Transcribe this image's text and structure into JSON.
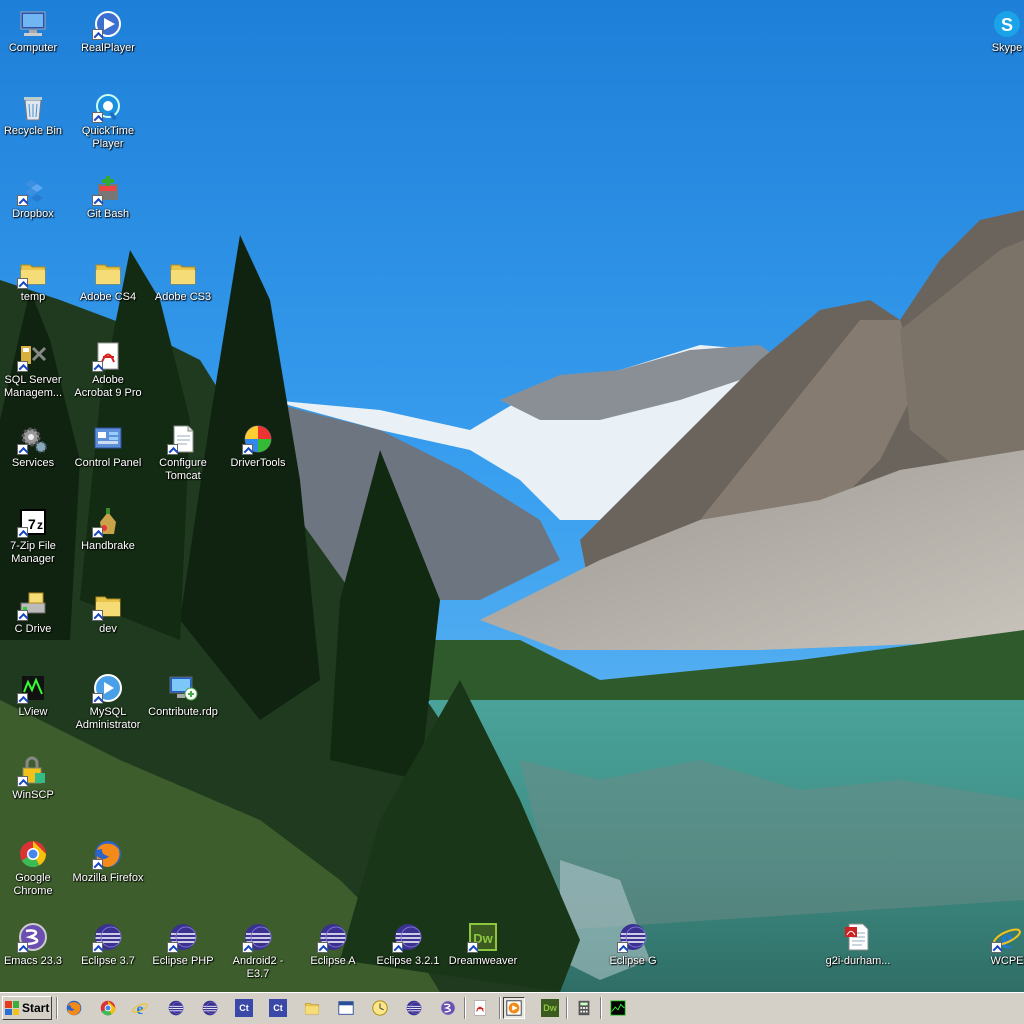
{
  "desktop": {
    "icons": [
      {
        "id": "computer",
        "label": "Computer",
        "icon": "computer-icon",
        "shortcut": false
      },
      {
        "id": "realplayer",
        "label": "RealPlayer",
        "icon": "realplayer-icon",
        "shortcut": true
      },
      {
        "id": "skype",
        "label": "Skype",
        "icon": "skype-icon",
        "shortcut": false
      },
      {
        "id": "recycle-bin",
        "label": "Recycle Bin",
        "icon": "recycle-bin-icon",
        "shortcut": false
      },
      {
        "id": "quicktime",
        "label": "QuickTime Player",
        "icon": "quicktime-icon",
        "shortcut": true
      },
      {
        "id": "dropbox",
        "label": "Dropbox",
        "icon": "dropbox-icon",
        "shortcut": true
      },
      {
        "id": "git-bash",
        "label": "Git Bash",
        "icon": "git-bash-icon",
        "shortcut": true
      },
      {
        "id": "temp",
        "label": "temp",
        "icon": "folder-icon",
        "shortcut": true
      },
      {
        "id": "adobe-cs4",
        "label": "Adobe CS4",
        "icon": "folder-icon",
        "shortcut": false
      },
      {
        "id": "adobe-cs3",
        "label": "Adobe CS3",
        "icon": "folder-icon",
        "shortcut": false
      },
      {
        "id": "sql-server",
        "label": "SQL Server Managem...",
        "icon": "sql-server-icon",
        "shortcut": true
      },
      {
        "id": "acrobat",
        "label": "Adobe Acrobat 9 Pro",
        "icon": "acrobat-icon",
        "shortcut": true
      },
      {
        "id": "services",
        "label": "Services",
        "icon": "services-gear-icon",
        "shortcut": true
      },
      {
        "id": "control-panel",
        "label": "Control Panel",
        "icon": "control-panel-icon",
        "shortcut": false
      },
      {
        "id": "configure-tomcat",
        "label": "Configure Tomcat",
        "icon": "document-icon",
        "shortcut": true
      },
      {
        "id": "drivertools",
        "label": "DriverTools",
        "icon": "drivertools-icon",
        "shortcut": true
      },
      {
        "id": "7zip",
        "label": "7-Zip File Manager",
        "icon": "7zip-icon",
        "shortcut": true
      },
      {
        "id": "handbrake",
        "label": "Handbrake",
        "icon": "handbrake-icon",
        "shortcut": true
      },
      {
        "id": "c-drive",
        "label": "C Drive",
        "icon": "drive-icon",
        "shortcut": true
      },
      {
        "id": "dev",
        "label": "dev",
        "icon": "folder-icon",
        "shortcut": true
      },
      {
        "id": "lview",
        "label": "LView",
        "icon": "lview-icon",
        "shortcut": true
      },
      {
        "id": "mysql-admin",
        "label": "MySQL Administrator",
        "icon": "mysql-icon",
        "shortcut": true
      },
      {
        "id": "contribute-rdp",
        "label": "Contribute.rdp",
        "icon": "remote-desktop-icon",
        "shortcut": false
      },
      {
        "id": "winscp",
        "label": "WinSCP",
        "icon": "winscp-icon",
        "shortcut": true
      },
      {
        "id": "chrome",
        "label": "Google Chrome",
        "icon": "chrome-icon",
        "shortcut": false
      },
      {
        "id": "firefox",
        "label": "Mozilla Firefox",
        "icon": "firefox-icon",
        "shortcut": true
      },
      {
        "id": "emacs",
        "label": "Emacs 23.3",
        "icon": "emacs-icon",
        "shortcut": true
      },
      {
        "id": "eclipse-37",
        "label": "Eclipse 3.7",
        "icon": "eclipse-icon",
        "shortcut": true
      },
      {
        "id": "eclipse-php",
        "label": "Eclipse PHP",
        "icon": "eclipse-icon",
        "shortcut": true
      },
      {
        "id": "android2",
        "label": "Android2 - E3.7",
        "icon": "eclipse-icon",
        "shortcut": true
      },
      {
        "id": "eclipse-a",
        "label": "Eclipse A",
        "icon": "eclipse-icon",
        "shortcut": true
      },
      {
        "id": "eclipse-321",
        "label": "Eclipse 3.2.1",
        "icon": "eclipse-icon",
        "shortcut": true
      },
      {
        "id": "dreamweaver",
        "label": "Dreamweaver",
        "icon": "dreamweaver-icon",
        "shortcut": true
      },
      {
        "id": "eclipse-g",
        "label": "Eclipse G",
        "icon": "eclipse-icon",
        "shortcut": true
      },
      {
        "id": "g2i-durham",
        "label": "g2i-durham...",
        "icon": "pdf-document-icon",
        "shortcut": false
      },
      {
        "id": "wcpe",
        "label": "WCPE",
        "icon": "ie-icon",
        "shortcut": true
      }
    ]
  },
  "taskbar": {
    "start_label": "Start",
    "quicklaunch": [
      {
        "icon": "firefox-icon",
        "text": ""
      },
      {
        "icon": "chrome-icon",
        "text": ""
      },
      {
        "icon": "ie-icon",
        "text": ""
      },
      {
        "icon": "eclipse-icon",
        "text": ""
      },
      {
        "icon": "eclipse-icon",
        "text": ""
      },
      {
        "icon": "ct-icon",
        "text": "Ct"
      },
      {
        "icon": "ct-icon",
        "text": "Ct"
      },
      {
        "icon": "folder-icon",
        "text": ""
      },
      {
        "icon": "window-icon",
        "text": ""
      },
      {
        "icon": "clock-icon",
        "text": ""
      },
      {
        "icon": "eclipse-icon",
        "text": ""
      },
      {
        "icon": "emacs-icon",
        "text": ""
      },
      {
        "icon": "acrobat-icon",
        "text": ""
      },
      {
        "icon": "media-player-icon",
        "text": ""
      },
      {
        "icon": "dreamweaver-icon",
        "text": "Dw"
      },
      {
        "icon": "calculator-icon",
        "text": ""
      },
      {
        "icon": "task-manager-icon",
        "text": ""
      }
    ]
  }
}
